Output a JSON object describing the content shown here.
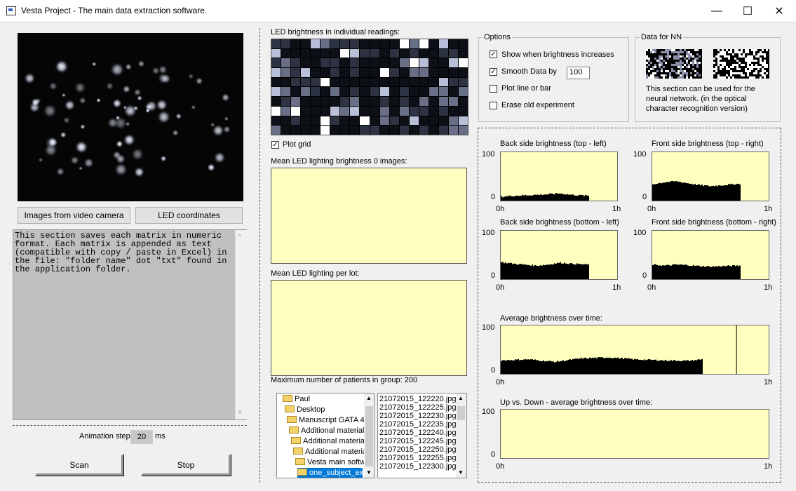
{
  "window": {
    "title": "Vesta Project - The main data extraction software.",
    "minimize": "—",
    "maximize": "☐",
    "close": "✕"
  },
  "left": {
    "video_button": "Images from video camera",
    "led_button": "LED coordinates",
    "info_text": "This section saves each matrix in numeric format. Each matrix is appended as text (compatible with copy / paste in Excel) in the file: \"folder name\" dot \"txt\" found in the application folder.",
    "animation_label": "Animation step",
    "animation_value": "20",
    "animation_unit": "ms",
    "scan_button": "Scan",
    "stop_button": "Stop"
  },
  "middle": {
    "led_title": "LED brightness in individual readings:",
    "plot_grid_label": "Plot grid",
    "plot_grid_checked": true,
    "mean_images_label": "Mean LED lighting brightness 0 images:",
    "mean_lot_label": "Mean LED lighting per lot:",
    "max_patients_label": "Maximum number of patients in group: 200",
    "tree": [
      {
        "label": "Paul",
        "indent": 0
      },
      {
        "label": "Desktop",
        "indent": 1
      },
      {
        "label": "Manuscript GATA 4",
        "indent": 2
      },
      {
        "label": "Additional materials",
        "indent": 3
      },
      {
        "label": "Additional material",
        "indent": 4
      },
      {
        "label": "Additional materia",
        "indent": 5
      },
      {
        "label": "Vesta main softw",
        "indent": 6
      },
      {
        "label": "one_subject_ex",
        "indent": 7,
        "selected": true
      }
    ],
    "files": [
      "21072015_122220.jpg",
      "21072015_122225.jpg",
      "21072015_122230.jpg",
      "21072015_122235.jpg",
      "21072015_122240.jpg",
      "21072015_122245.jpg",
      "21072015_122250.jpg",
      "21072015_122255.jpg",
      "21072015_122300.jpg"
    ]
  },
  "options": {
    "title": "Options",
    "show_increase": "Show when brightness increases",
    "show_increase_checked": true,
    "smooth": "Smooth Data by",
    "smooth_checked": true,
    "smooth_value": "100",
    "plot_line": "Plot line or bar",
    "plot_line_checked": false,
    "erase": "Erase old experiment",
    "erase_checked": false
  },
  "nn": {
    "title": "Data for NN",
    "text": "This section can be used for the neural network. (in the optical character recognition version)"
  },
  "charts": {
    "back_top": {
      "title": "Back side brightness (top - left)"
    },
    "front_top": {
      "title": "Front side brightness  (top - right)"
    },
    "back_bottom": {
      "title": "Back side brightness  (bottom - left)"
    },
    "front_bottom": {
      "title": "Front side brightness  (bottom - right)"
    },
    "average": {
      "title": "Average brightness over time:"
    },
    "updown": {
      "title": "Up vs. Down - average brightness over time:"
    },
    "y_max": "100",
    "y_min": "0",
    "x_start": "0h",
    "x_end": "1h"
  },
  "chart_data": [
    {
      "type": "area",
      "title": "Back side brightness (top - left)",
      "ylim": [
        0,
        100
      ],
      "xlim": [
        0,
        1
      ],
      "x": [
        0,
        0.1,
        0.2,
        0.3,
        0.4,
        0.5,
        0.6,
        0.75
      ],
      "values": [
        8,
        10,
        11,
        12,
        13,
        15,
        12,
        10
      ]
    },
    {
      "type": "area",
      "title": "Front side brightness  (top - right)",
      "ylim": [
        0,
        100
      ],
      "xlim": [
        0,
        1
      ],
      "x": [
        0,
        0.1,
        0.2,
        0.3,
        0.4,
        0.5,
        0.6,
        0.75
      ],
      "values": [
        34,
        38,
        40,
        36,
        32,
        30,
        32,
        35
      ]
    },
    {
      "type": "area",
      "title": "Back side brightness  (bottom - left)",
      "ylim": [
        0,
        100
      ],
      "xlim": [
        0,
        1
      ],
      "x": [
        0,
        0.1,
        0.2,
        0.3,
        0.4,
        0.5,
        0.6,
        0.75
      ],
      "values": [
        35,
        32,
        30,
        28,
        30,
        34,
        32,
        30
      ]
    },
    {
      "type": "area",
      "title": "Front side brightness  (bottom - right)",
      "ylim": [
        0,
        100
      ],
      "xlim": [
        0,
        1
      ],
      "x": [
        0,
        0.1,
        0.2,
        0.3,
        0.4,
        0.5,
        0.6,
        0.75
      ],
      "values": [
        30,
        28,
        30,
        29,
        27,
        26,
        27,
        28
      ]
    },
    {
      "type": "area",
      "title": "Average brightness over time:",
      "ylim": [
        0,
        100
      ],
      "xlim": [
        0,
        1
      ],
      "x": [
        0,
        0.1,
        0.2,
        0.3,
        0.4,
        0.5,
        0.6,
        0.7,
        0.75
      ],
      "values": [
        28,
        30,
        25,
        32,
        34,
        30,
        28,
        27,
        30
      ]
    },
    {
      "type": "area",
      "title": "Up vs. Down - average brightness over time:",
      "ylim": [
        0,
        100
      ],
      "xlim": [
        0,
        1
      ],
      "x": [],
      "values": []
    }
  ]
}
